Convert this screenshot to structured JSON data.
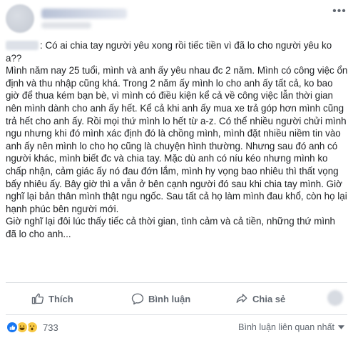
{
  "post": {
    "author_hidden": true,
    "question_prefix": ": Có ai chia tay người yêu xong rồi tiếc tiền vì đã lo cho người yêu ko a??",
    "paragraph1": "Mình năm nay 25 tuổi, mình và anh ấy yêu nhau đc 2 năm. Mình có công việc ổn định và thu nhập cũng khá. Trong 2 năm ấy mình lo cho anh ấy tất cả, ko bao giờ để thua kém bạn bè, vì mình có điều kiện kể cả về công việc lẫn thời gian nên mình dành cho anh ấy hết. Kể cả khi anh ấy mua xe trả góp hơn mình cũng trả hết cho anh ấy. Rồi mọi thứ mình lo hết từ a-z. Có thể nhiều người chửi mình ngu nhưng khi đó mình xác định đó là chồng mình, mình đặt nhiều niềm tin vào anh ấy nên mình lo cho họ cũng là chuyện hình thường. Nhưng sau đó anh có người khác, mình biết đc và chia tay. Mặc dù anh có níu kéo nhưng mình ko chấp nhận, cảm giác ấy nó đau đớn lắm, mình hy vọng bao nhiêu thì thất vọng bấy nhiêu ấy. Bây giờ thì a vẫn ở bên cạnh người đó sau khi chia tay mình. Giờ nghĩ lại bản thân mình thật ngu ngốc. Sau tất cả họ làm mình đau khổ, còn họ lại hạnh phúc bên người mới.",
    "paragraph2": "Giờ nghĩ lại đôi lúc thấy tiếc cả thời gian, tình cảm và cả tiền, những thứ mình đã lo cho anh..."
  },
  "actions": {
    "like_label": "Thích",
    "comment_label": "Bình luận",
    "share_label": "Chia sẻ"
  },
  "reactions": {
    "count": "733",
    "types": [
      "like-icon",
      "haha-icon",
      "wow-icon"
    ],
    "sort_label": "Bình luận liên quan nhất"
  },
  "colors": {
    "text": "#1c1e21",
    "muted": "#606770",
    "like_blue": "#1877f2",
    "emoji_yellow": "#f7c844",
    "divider": "#dadde1"
  }
}
